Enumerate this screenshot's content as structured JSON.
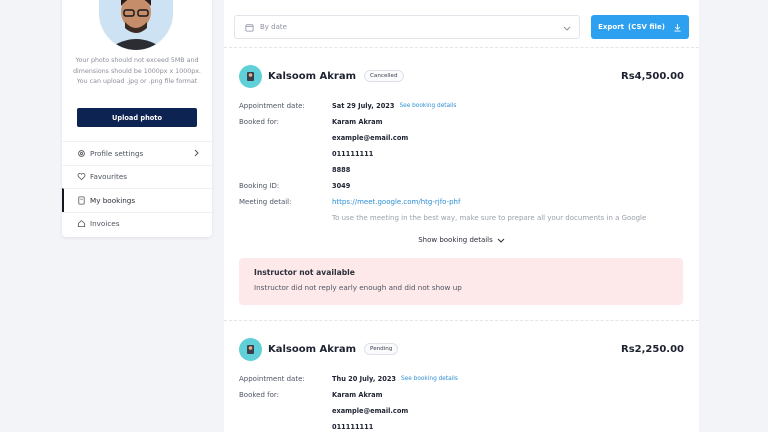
{
  "sidebar": {
    "photo_hint": "Your photo should not exceed 5MB and dimensions should be 1000px x 1000px. You can upload .jpg or .png file format",
    "upload_label": "Upload photo",
    "items": [
      {
        "label": "Profile settings",
        "icon": "gear-icon"
      },
      {
        "label": "Favourites",
        "icon": "heart-icon"
      },
      {
        "label": "My bookings",
        "icon": "book-icon",
        "active": true
      },
      {
        "label": "Invoices",
        "icon": "home-icon"
      }
    ]
  },
  "toolbar": {
    "filter_placeholder": "By date",
    "export_label": "Export",
    "export_suffix": "(CSV file)"
  },
  "bookings": [
    {
      "name": "Kalsoom Akram",
      "status": "Cancelled",
      "price": "Rs4,500.00",
      "appointment_label": "Appointment date:",
      "appointment_date": "Sat 29 July, 2023",
      "see_details": "See booking details",
      "booked_for_label": "Booked for:",
      "booked_for": [
        "Karam Akram",
        "example@email.com",
        "011111111",
        "8888"
      ],
      "booking_id_label": "Booking ID:",
      "booking_id": "3049",
      "meeting_label": "Meeting detail:",
      "meeting_link": "https://meet.google.com/htg-rjfo-phf",
      "meeting_note": "To use the meeting in the best way, make sure to prepare all your documents in a Google",
      "show_details": "Show booking details",
      "alert_title": "Instructor not available",
      "alert_text": "Instructor did not reply early enough and did not show up"
    },
    {
      "name": "Kalsoom Akram",
      "status": "Pending",
      "price": "Rs2,250.00",
      "appointment_label": "Appointment date:",
      "appointment_date": "Thu 20 July, 2023",
      "see_details": "See booking details",
      "booked_for_label": "Booked for:",
      "booked_for": [
        "Karam Akram",
        "example@email.com",
        "011111111"
      ]
    }
  ],
  "colors": {
    "accent": "#2da0f0",
    "navy": "#0d2452",
    "alert_bg": "#fde9ea",
    "link": "#2f8fd4"
  }
}
